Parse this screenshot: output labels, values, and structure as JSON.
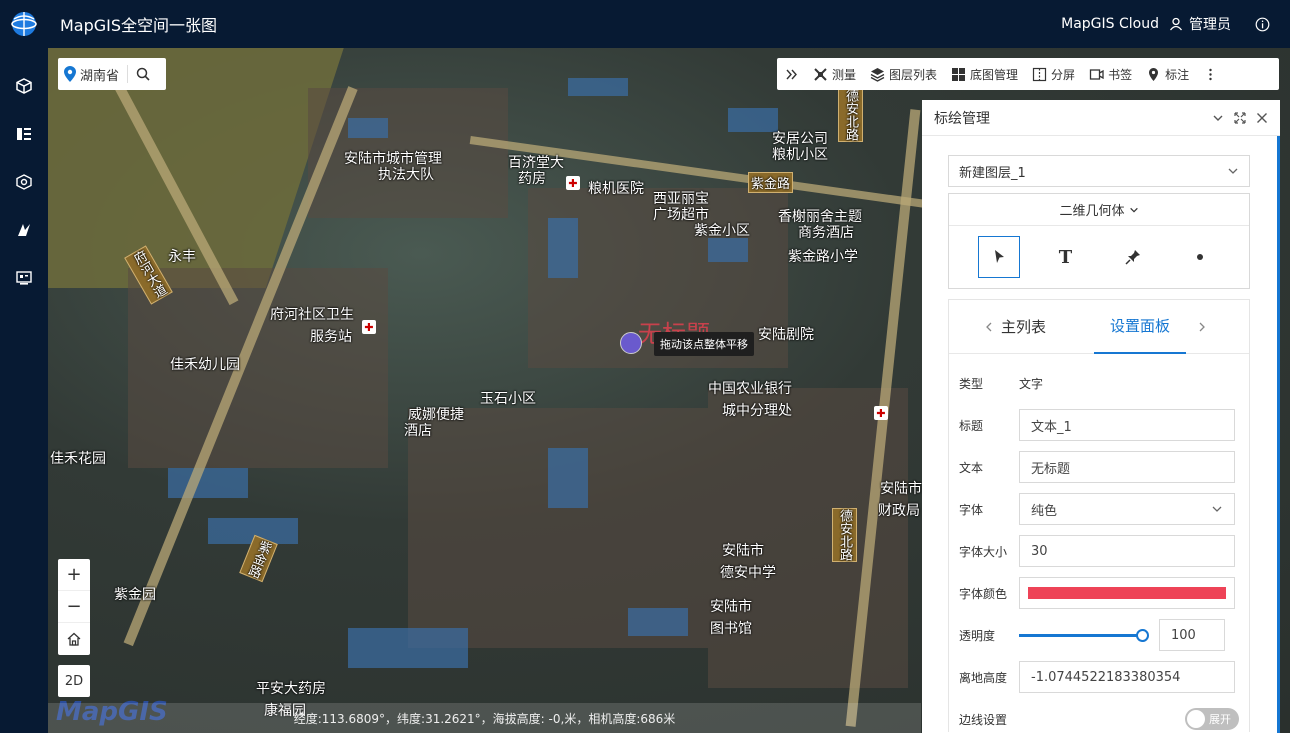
{
  "app": {
    "title": "MapGIS全空间一张图",
    "cloud": "MapGIS Cloud",
    "user": "管理员"
  },
  "sidebar": {
    "items": [
      "cube-icon",
      "layers-list-icon",
      "model-icon",
      "analysis-icon",
      "screen-icon"
    ]
  },
  "search": {
    "region": "湖南省"
  },
  "toolbar": {
    "items": [
      "测量",
      "图层列表",
      "底图管理",
      "分屏",
      "书签",
      "标注"
    ]
  },
  "map": {
    "labels": [
      "安陆市城市管理",
      "执法大队",
      "百济堂大",
      "药房",
      "粮机医院",
      "西亚丽宝",
      "广场超市",
      "紫金小区",
      "紫金路",
      "安居公司",
      "粮机小区",
      "香榭丽舍主题",
      "商务酒店",
      "紫金路小学",
      "府河社区卫生",
      "服务站",
      "佳禾幼儿园",
      "玉石小区",
      "威娜便捷",
      "酒店",
      "安陆剧院",
      "中国农业银行",
      "城中分理处",
      "安陆市",
      "德安中学",
      "安陆市",
      "图书馆",
      "平安大药房",
      "康福园",
      "紫金园",
      "佳禾花园",
      "安陆市",
      "财政局",
      "永丰"
    ],
    "roads": [
      "府河大道",
      "紫金路",
      "德安北路",
      "德安北路",
      "紫金路"
    ],
    "tooltip": "拖动该点整体平移",
    "marker_text": "无标题",
    "mode_button": "2D",
    "watermark": "MapGIS",
    "status": "经度:113.6809°，纬度:31.2621°，海拔高度: -0,米，相机高度:686米"
  },
  "panel": {
    "title": "标绘管理",
    "layer_select": "新建图层_1",
    "geometry_title": "二维几何体",
    "tabs": [
      "主列表",
      "设置面板"
    ],
    "active_tab": 1,
    "fields": {
      "type_label": "类型",
      "type_value": "文字",
      "title_label": "标题",
      "title_value": "文本_1",
      "text_label": "文本",
      "text_value": "无标题",
      "font_label": "字体",
      "font_value": "纯色",
      "font_size_label": "字体大小",
      "font_size_value": "30",
      "font_color_label": "字体颜色",
      "font_color_value": "#ee4357",
      "opacity_label": "透明度",
      "opacity_value": "100",
      "height_label": "离地高度",
      "height_value": "-1.0744522183380354",
      "border_label": "边线设置",
      "border_toggle": "展开"
    }
  }
}
